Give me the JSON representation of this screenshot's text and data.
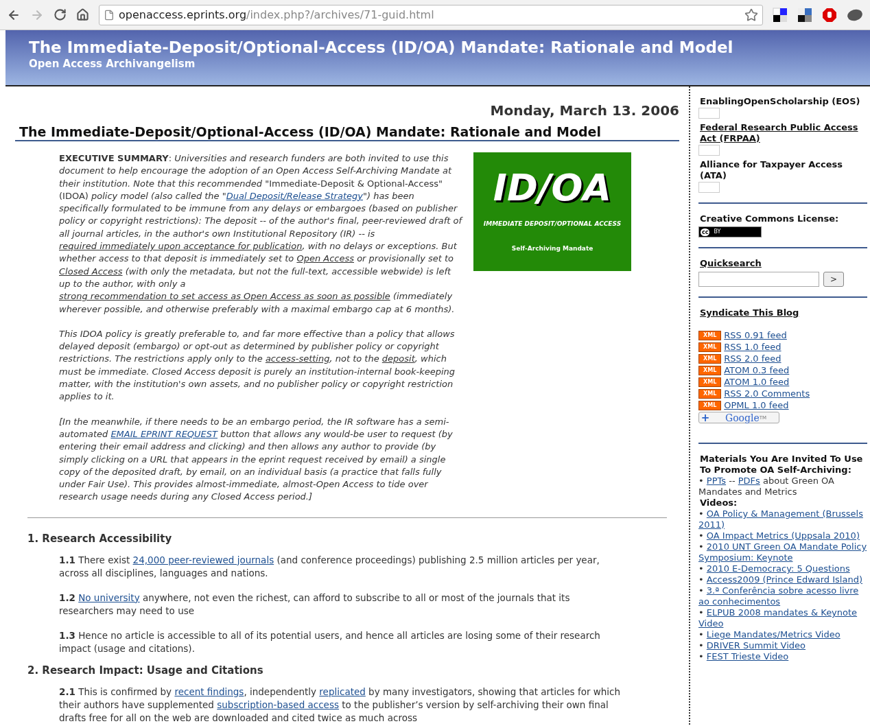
{
  "browser": {
    "url_host": "openaccess.eprints.org",
    "url_path": "/index.php?/archives/71-guid.html",
    "forward_enabled": false
  },
  "header": {
    "title": "The Immediate-Deposit/Optional-Access (ID/OA) Mandate: Rationale and Model",
    "subtitle": "Open Access Archivangelism"
  },
  "entry": {
    "date": "Monday, March 13. 2006",
    "title": "The Immediate-Deposit/Optional-Access (ID/OA) Mandate: Rationale and Model",
    "logo": {
      "title": "ID/OA",
      "subtitle": "IMMEDIATE DEPOSIT/OPTIONAL ACCESS",
      "caption": "Self-Archiving Mandate"
    },
    "paragraphs": [
      {
        "italic": true,
        "segments": [
          {
            "kind": "bold",
            "text": "EXECUTIVE SUMMARY"
          },
          {
            "kind": "upright",
            "text": ": "
          },
          {
            "kind": "text",
            "text": "Universities and research funders are both invited to use this document to help encourage the adoption of an Open Access Self-Archiving Mandate at their institution. Note that this recommended "
          },
          {
            "kind": "upright",
            "text": "\"Immediate-Deposit & Optional-Access\" (IDOA)"
          },
          {
            "kind": "text",
            "text": " policy model (also called the \""
          },
          {
            "kind": "link",
            "text": "Dual Deposit/Release Strategy"
          },
          {
            "kind": "text",
            "text": "\") has been specifically formulated to be immune from any delays or embargoes (based on publisher policy or copyright restrictions): The deposit -- of the author's final, peer-reviewed draft of all journal articles, in the author's own Institutional Repository (IR) -- is "
          },
          {
            "kind": "ref",
            "text": "required immediately upon acceptance for publication"
          },
          {
            "kind": "text",
            "text": ", with no delays or exceptions. But whether access to that deposit is immediately set to "
          },
          {
            "kind": "ref",
            "text": "Open Access"
          },
          {
            "kind": "text",
            "text": " or provisionally set to "
          },
          {
            "kind": "ref",
            "text": "Closed Access"
          },
          {
            "kind": "text",
            "text": " (with only the metadata, but not the full-text, accessible webwide) is left up to the author, with only a "
          },
          {
            "kind": "ref",
            "text": "strong recommendation to set access as Open Access as soon as possible"
          },
          {
            "kind": "text",
            "text": " (immediately wherever possible, and otherwise preferably with a maximal embargo cap at 6 months)."
          }
        ]
      },
      {
        "italic": true,
        "segments": [
          {
            "kind": "text",
            "text": "This IDOA policy is greatly preferable to, and far more effective than a policy that allows delayed deposit (embargo) or opt-out as determined by publisher policy or copyright restrictions. The restrictions apply only to the "
          },
          {
            "kind": "ref",
            "text": "access-setting"
          },
          {
            "kind": "text",
            "text": ", not to the "
          },
          {
            "kind": "ref",
            "text": "deposit"
          },
          {
            "kind": "text",
            "text": ", which must be immediate. Closed Access deposit is purely an institution-internal book-keeping matter, with the institution's own assets, and no publisher policy or copyright restriction applies to it."
          }
        ]
      },
      {
        "italic": true,
        "segments": [
          {
            "kind": "text",
            "text": "[In the meanwhile, if there needs to be an embargo period, the IR software has a semi-automated "
          },
          {
            "kind": "link",
            "text": "EMAIL EPRINT REQUEST"
          },
          {
            "kind": "text",
            "text": " button that allows any would-be user to request (by entering their email address and clicking) and then allows any author to provide (by simply clicking on a URL that appears in the eprint request received by email) a single copy of the deposited draft, by email, on an individual basis (a practice that falls fully under Fair Use). This provides almost-immediate, almost-Open Access to tide over research usage needs during any Closed Access period.]"
          }
        ]
      }
    ],
    "sections": [
      {
        "heading": "1. Research Accessibility",
        "items": [
          {
            "number": "1.1",
            "segments": [
              {
                "kind": "text",
                "text": "There exist "
              },
              {
                "kind": "link",
                "text": "24,000 peer-reviewed journals"
              },
              {
                "kind": "text",
                "text": " (and conference proceedings) publishing 2.5 million articles per year, across all disciplines, languages and nations."
              }
            ]
          },
          {
            "number": "1.2",
            "segments": [
              {
                "kind": "link",
                "text": "No university"
              },
              {
                "kind": "text",
                "text": " anywhere, not even the richest, can afford to subscribe to all or most of the journals that its researchers may need to use"
              }
            ]
          },
          {
            "number": "1.3",
            "segments": [
              {
                "kind": "text",
                "text": "Hence no article is accessible to all of its potential users, and hence all articles are losing some of their research impact (usage and citations)."
              }
            ]
          }
        ]
      },
      {
        "heading": "2. Research Impact: Usage and Citations",
        "items": [
          {
            "number": "2.1",
            "segments": [
              {
                "kind": "text",
                "text": "This is confirmed by "
              },
              {
                "kind": "link",
                "text": "recent findings"
              },
              {
                "kind": "text",
                "text": ", independently "
              },
              {
                "kind": "link",
                "text": "replicated"
              },
              {
                "kind": "text",
                "text": " by many investigators, showing that articles for which their authors have supplemented "
              },
              {
                "kind": "link",
                "text": "subscription-based access"
              },
              {
                "kind": "text",
                "text": " to the publisher’s version by self-archiving their own final drafts free for all on the web are downloaded and cited twice as much across"
              }
            ]
          }
        ]
      }
    ]
  },
  "sidebar": {
    "campaigns": [
      {
        "label": "EnablingOpenScholarship (EOS)",
        "link": false
      },
      {
        "label": "Federal Research Public Access Act (FRPAA)",
        "link": true
      },
      {
        "label": "Alliance for Taxpayer Access (ATA)",
        "link": false
      }
    ],
    "license": {
      "heading": "Creative Commons License:",
      "mark": "cc",
      "label": "BY"
    },
    "quicksearch": {
      "heading": "Quicksearch",
      "button": ">"
    },
    "syndicate": {
      "heading": "Syndicate This Blog",
      "feeds": [
        {
          "badge": "XML",
          "label": "RSS 0.91 feed"
        },
        {
          "badge": "XML",
          "label": "RSS 1.0 feed"
        },
        {
          "badge": "XML",
          "label": "RSS 2.0 feed"
        },
        {
          "badge": "XML",
          "label": "ATOM 0.3 feed"
        },
        {
          "badge": "XML",
          "label": "ATOM 1.0 feed"
        },
        {
          "badge": "XML",
          "label": "RSS 2.0 Comments"
        },
        {
          "badge": "XML",
          "label": "OPML 1.0 feed"
        }
      ],
      "google_button": {
        "plus": "+",
        "label": "Google",
        "tm": "TM"
      }
    },
    "materials": {
      "heading": "Materials You Are Invited To Use To Promote OA Self-Archiving:",
      "items": [
        {
          "kind": "bullet",
          "bullet": "•",
          "segments": [
            {
              "kind": "link",
              "text": "PPTs"
            },
            {
              "kind": "text",
              "text": " -- "
            },
            {
              "kind": "link",
              "text": "PDFs"
            },
            {
              "kind": "text",
              "text": " about Green OA Mandates and Metrics"
            }
          ]
        },
        {
          "kind": "label",
          "text": "Videos:"
        },
        {
          "kind": "bullet",
          "bullet": "•",
          "segments": [
            {
              "kind": "link",
              "text": "OA Policy & Management (Brussels 2011)"
            }
          ]
        },
        {
          "kind": "bullet",
          "bullet": "•",
          "segments": [
            {
              "kind": "link",
              "text": "OA Impact Metrics (Uppsala 2010)"
            }
          ]
        },
        {
          "kind": "bullet",
          "bullet": "•",
          "segments": [
            {
              "kind": "link",
              "text": "2010 UNT Green OA Mandate Policy Symposium: Keynote"
            }
          ]
        },
        {
          "kind": "bullet",
          "bullet": "•",
          "segments": [
            {
              "kind": "link",
              "text": "2010 E-Democracy: 5 Questions"
            }
          ]
        },
        {
          "kind": "bullet",
          "bullet": "•",
          "segments": [
            {
              "kind": "link",
              "text": "Access2009 (Prince Edward Island)"
            }
          ]
        },
        {
          "kind": "bullet",
          "bullet": "•",
          "segments": [
            {
              "kind": "link",
              "text": "3.ª Conferência sobre acesso livre ao conhecimentos"
            }
          ]
        },
        {
          "kind": "bullet",
          "bullet": "•",
          "segments": [
            {
              "kind": "link",
              "text": "ELPUB 2008 mandates & Keynote Video"
            }
          ]
        },
        {
          "kind": "bullet",
          "bullet": "•",
          "segments": [
            {
              "kind": "link",
              "text": "Liege Mandates/Metrics Video"
            }
          ]
        },
        {
          "kind": "bullet",
          "bullet": "•",
          "segments": [
            {
              "kind": "link",
              "text": "DRIVER Summit Video"
            }
          ]
        },
        {
          "kind": "bullet",
          "bullet": "•",
          "segments": [
            {
              "kind": "link",
              "text": "FEST Trieste Video"
            }
          ]
        }
      ]
    }
  }
}
